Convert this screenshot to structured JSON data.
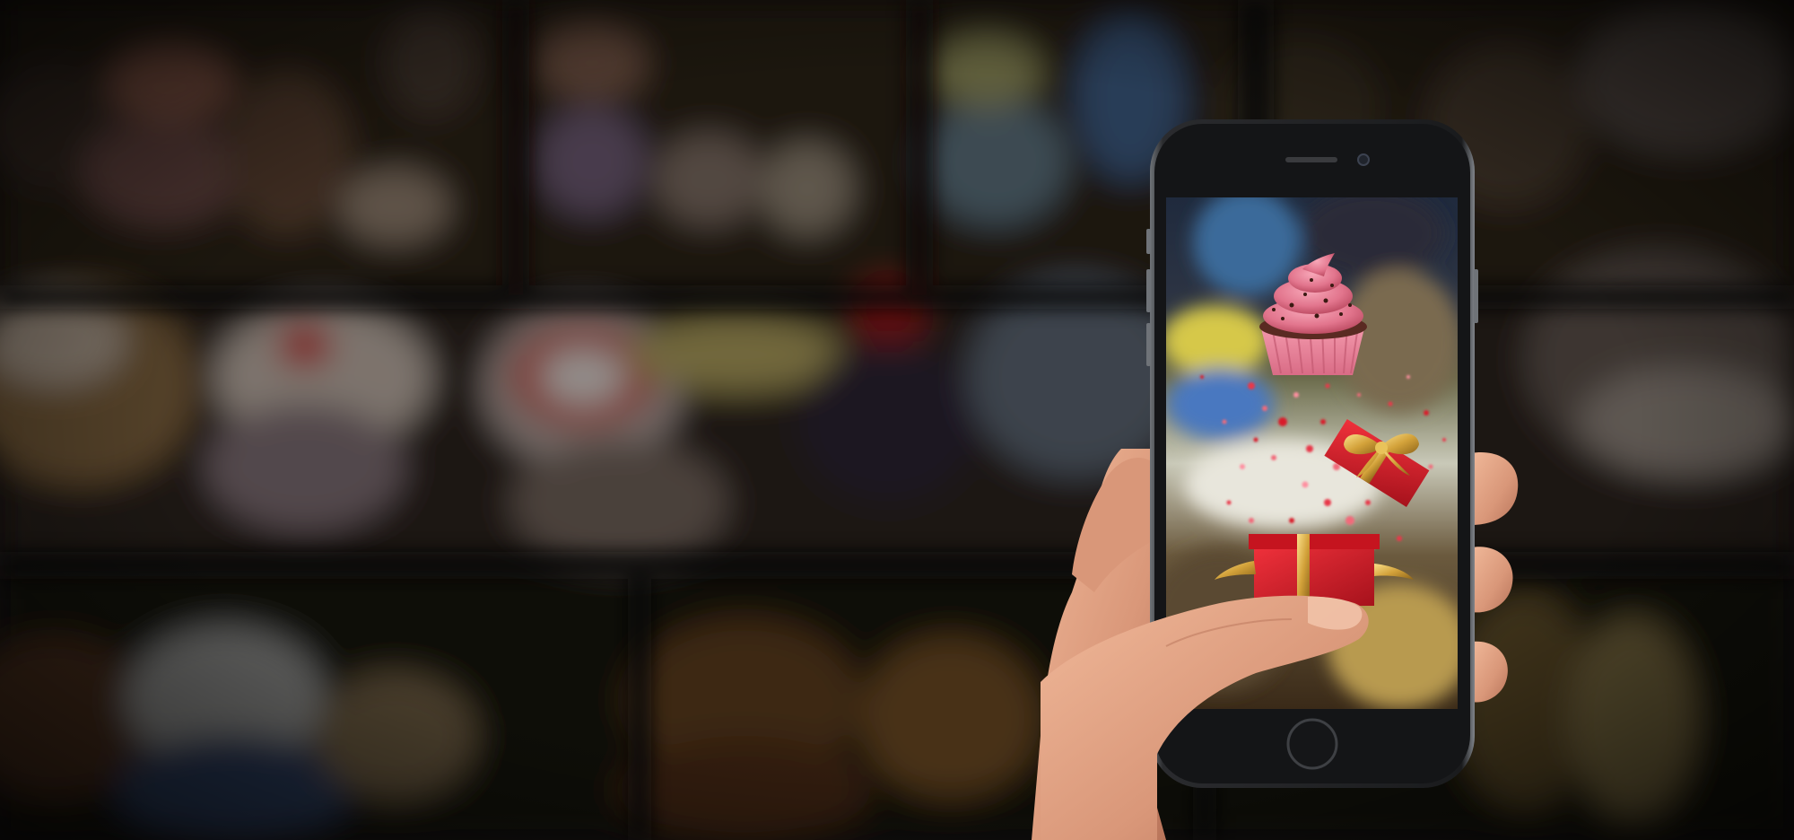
{
  "scene": {
    "subject": "hand-holding-smartphone",
    "background": "blurred-bakery-display-case",
    "phone_color": "space-gray",
    "screen_content": [
      "cupcake",
      "open-gift-box",
      "heart-confetti"
    ]
  },
  "colors": {
    "background_dark": "#0b0908",
    "frosting_pink": "#e97a92",
    "gift_red": "#d91f2b",
    "ribbon_gold": "#d9a83a",
    "skin": "#e3a888",
    "phone_body": "#1b1c1e",
    "phone_bezel": "#8c9096"
  }
}
